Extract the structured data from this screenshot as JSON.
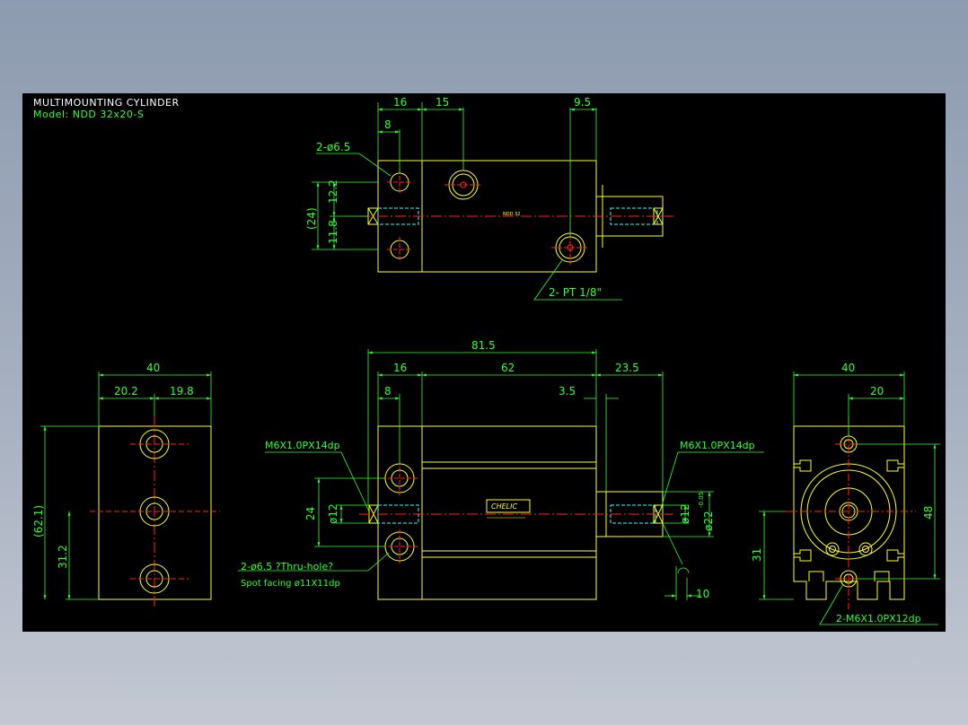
{
  "colors": {
    "background": "#000000",
    "outline": "#ffff33",
    "dimension": "#33ff33",
    "centerline": "#ff2222",
    "thread": "#33ffff",
    "text_dim": "#ffffff"
  },
  "title": {
    "line1": "MULTIMOUNTING CYLINDER",
    "line2": "Model: NDD 32x20-S"
  },
  "top_view": {
    "dim_16": "16",
    "dim_15": "15",
    "dim_9_5": "9.5",
    "dim_8": "8",
    "holes_label": "2-ø6.5",
    "dim_12_2": "12.2",
    "dim_11_8": "11.8",
    "dim_24": "(24)",
    "port_label": "2- PT 1/8\"",
    "body_mark": "NDD 32"
  },
  "front_view": {
    "dim_81_5": "81.5",
    "dim_16": "16",
    "dim_62": "62",
    "dim_23_5": "23.5",
    "dim_8": "8",
    "dim_3_5": "3.5",
    "thread_left": "M6X1.0PX14dp",
    "thread_right": "M6X1.0PX14dp",
    "dim_24": "24",
    "dim_phi12_left": "ø12",
    "dim_phi12_right": "ø12",
    "dim_phi22": "ø22",
    "dim_tol": "-0.05",
    "holes_label": "2-ø6.5 ?Thru-hole?",
    "spot_facing": "Spot facing  ø11X11dp",
    "dim_10": "10",
    "logo": "CHELIC"
  },
  "left_view": {
    "dim_40": "40",
    "dim_20_2": "20.2",
    "dim_19_8": "19.8",
    "dim_62_1": "(62.1)",
    "dim_31_2": "31.2"
  },
  "right_view": {
    "dim_40": "40",
    "dim_20": "20",
    "dim_48": "48",
    "dim_31": "31",
    "thread_label": "2-M6X1.0PX12dp"
  }
}
